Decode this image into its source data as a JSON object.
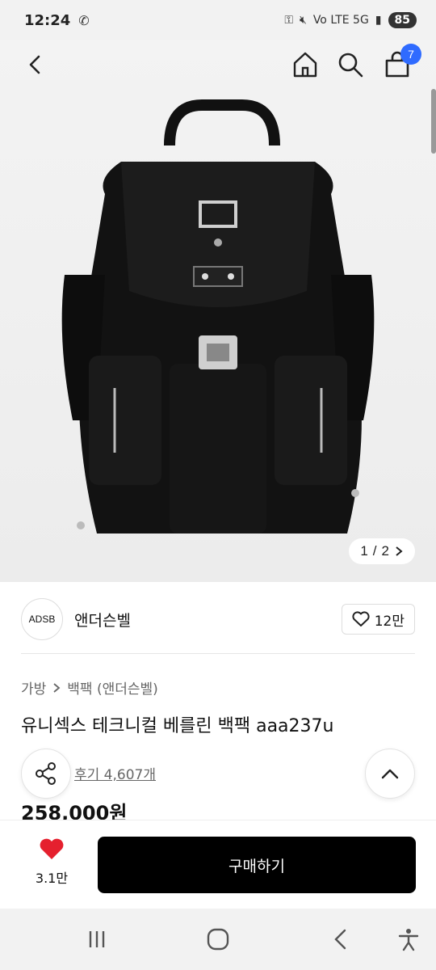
{
  "status_bar": {
    "time": "12:24",
    "network": "Vo LTE 5G",
    "battery": "85"
  },
  "header": {
    "cart_count": "7"
  },
  "gallery": {
    "current": "1",
    "separator": "/",
    "total": "2"
  },
  "brand": {
    "logo_text": "ADSB",
    "name": "앤더슨벨",
    "likes": "12만"
  },
  "breadcrumb": {
    "items": [
      "가방",
      "백팩 (앤더슨벨)"
    ]
  },
  "product": {
    "title": "유니섹스 테크니컬 베를린 백팩 aaa237u",
    "review_link": "후기 4,607개",
    "price": "258,000원"
  },
  "bottom_bar": {
    "wish_count": "3.1만",
    "buy_label": "구매하기"
  },
  "colors": {
    "accent_blue": "#2f6bff",
    "buy_button": "#000000",
    "heart_red": "#e5202e"
  },
  "icons": [
    "back-arrow-icon",
    "home-icon",
    "search-icon",
    "cart-icon",
    "heart-icon",
    "share-icon",
    "chevron-up-icon",
    "recent-apps-icon",
    "home-circle-icon",
    "back-icon",
    "accessibility-icon"
  ]
}
